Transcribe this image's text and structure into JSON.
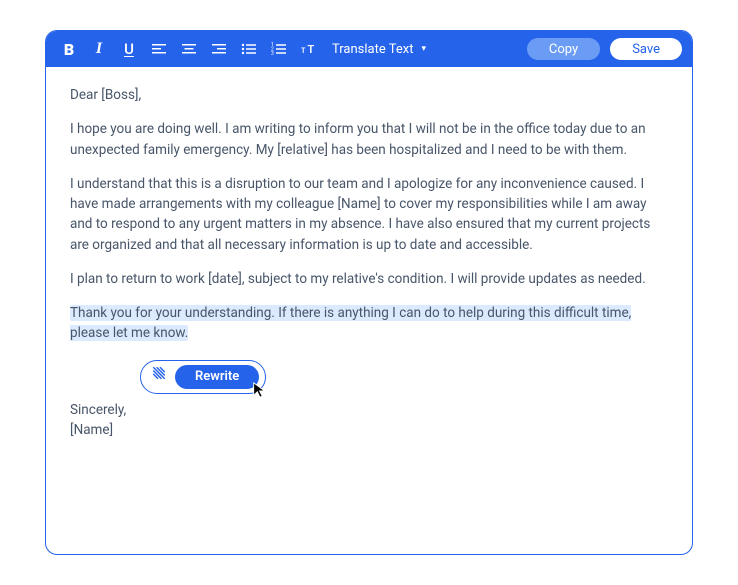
{
  "toolbar": {
    "bold": "B",
    "italic": "I",
    "underline": "U",
    "text_size": "T",
    "translate_label": "Translate Text",
    "copy_label": "Copy",
    "save_label": "Save"
  },
  "email": {
    "greeting": "Dear [Boss],",
    "para1": "I hope you are doing well. I am writing to inform you that I will not be in the office today due to an unexpected family emergency. My [relative] has been hospitalized and I need to be with them.",
    "para2": "I understand that this is a disruption to our team and I apologize for any inconvenience caused. I have made arrangements with my colleague [Name] to cover my responsibilities while I am away and to respond to any urgent matters in my absence. I have also ensured that my current projects are organized and that all necessary information is up to date and accessible.",
    "para3": "I plan to return to work [date], subject to my relative's condition. I will provide updates as needed.",
    "highlighted": "Thank you for your understanding. If there is anything I can do to help during this difficult time, please let me know.",
    "signoff": "Sincerely,",
    "signature": "[Name]"
  },
  "popover": {
    "rewrite_label": "Rewrite"
  }
}
